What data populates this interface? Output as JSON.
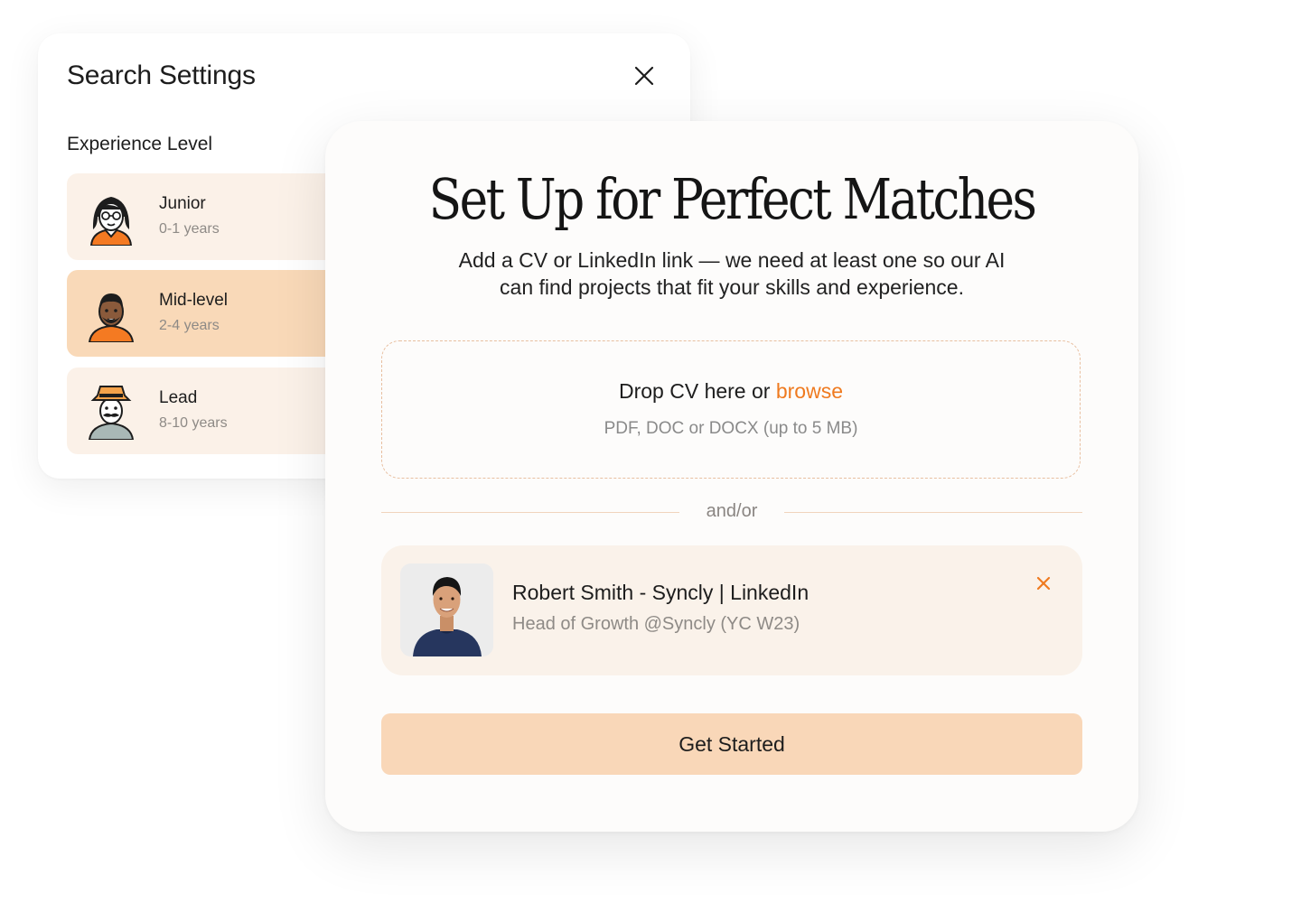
{
  "settings": {
    "title": "Search Settings",
    "section_label": "Experience Level",
    "levels": [
      {
        "name": "Junior",
        "years": "0-1 years",
        "selected": false
      },
      {
        "name": "Mid-level",
        "years": "2-4 years",
        "selected": true
      },
      {
        "name": "Lead",
        "years": "8-10 years",
        "selected": false
      }
    ]
  },
  "modal": {
    "title": "Set Up for Perfect Matches",
    "subtitle_line1": "Add a CV or LinkedIn link — we need at least one so our AI",
    "subtitle_line2": "can find projects that fit your skills and experience.",
    "dropzone": {
      "prefix": "Drop CV here or ",
      "browse": "browse",
      "hint": "PDF, DOC or DOCX (up to 5 MB)"
    },
    "divider_text": "and/or",
    "linkedin": {
      "name": "Robert Smith - Syncly | LinkedIn",
      "role": "Head of Growth @Syncly (YC W23)"
    },
    "cta_label": "Get Started"
  },
  "colors": {
    "accent": "#ef7a1f",
    "card_bg": "#fbf1e8",
    "selected_bg": "#f9d9b8",
    "cta_bg": "#f9d7b8"
  },
  "icons": [
    "close-icon",
    "junior-avatar-icon",
    "mid-level-avatar-icon",
    "lead-avatar-icon",
    "remove-link-icon"
  ]
}
